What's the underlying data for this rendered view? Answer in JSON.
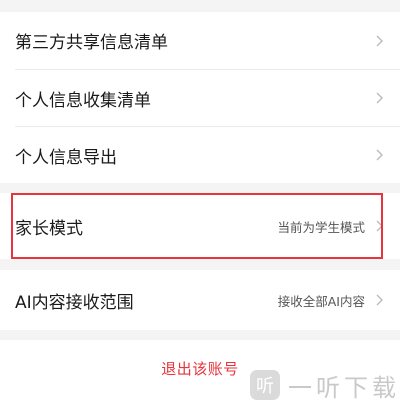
{
  "settings": {
    "items": [
      {
        "label": "第三方共享信息清单",
        "value": ""
      },
      {
        "label": "个人信息收集清单",
        "value": ""
      },
      {
        "label": "个人信息导出",
        "value": ""
      },
      {
        "label": "家长模式",
        "value": "当前为学生模式"
      },
      {
        "label": "AI内容接收范围",
        "value": "接收全部AI内容"
      }
    ],
    "logout_label": "退出该账号"
  },
  "watermark": {
    "logo_glyph": "听",
    "text": "一听下载"
  },
  "colors": {
    "accent": "#e8343c",
    "text_primary": "#1a1a1a",
    "text_secondary": "#555555",
    "chevron": "#bbbbbb",
    "background": "#f4f4f4"
  },
  "icons": {
    "row_arrow": "chevron-right-icon"
  }
}
